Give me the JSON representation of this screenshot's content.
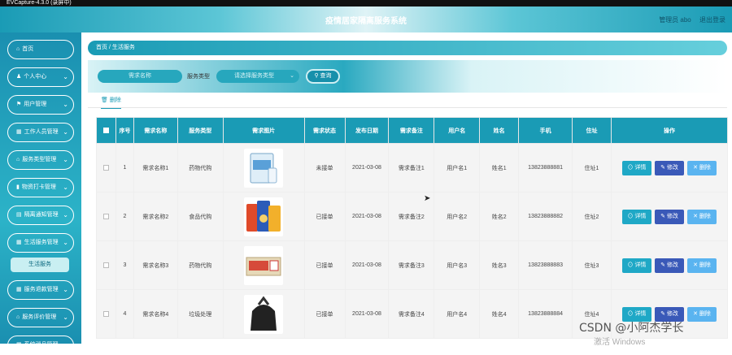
{
  "window_bar": {
    "title": "EVCapture-4.3.0 (录屏中)"
  },
  "header": {
    "title": "疫情居家隔离服务系统",
    "user_label": "管理员 abo",
    "logout_label": "退出登录"
  },
  "sidebar": {
    "items": [
      {
        "label": "首页",
        "icon": "home-icon"
      },
      {
        "label": "个人中心",
        "icon": "user-icon"
      },
      {
        "label": "用户管理",
        "icon": "flag-icon"
      },
      {
        "label": "工作人员管理",
        "icon": "grid-icon"
      },
      {
        "label": "服务类型管理",
        "icon": "home-icon"
      },
      {
        "label": "物资打卡管理",
        "icon": "chart-icon"
      },
      {
        "label": "隔离通知管理",
        "icon": "list-icon"
      },
      {
        "label": "生活服务管理",
        "icon": "grid-icon"
      },
      {
        "label": "生活服务",
        "icon": ""
      },
      {
        "label": "服务退款管理",
        "icon": "grid-icon"
      },
      {
        "label": "服务评价管理",
        "icon": "home-icon"
      },
      {
        "label": "系统消息管理",
        "icon": "grid-icon"
      }
    ]
  },
  "breadcrumb": {
    "home": "首页",
    "sep": "/",
    "current": "生活服务"
  },
  "search": {
    "name_placeholder": "需求名称",
    "type_label": "服务类型",
    "type_placeholder": "请选择服务类型",
    "search_button": "查询"
  },
  "toolbar": {
    "delete_label": "删除"
  },
  "table": {
    "headers": [
      "",
      "序号",
      "需求名称",
      "服务类型",
      "需求图片",
      "需求状态",
      "发布日期",
      "需求备注",
      "用户名",
      "姓名",
      "手机",
      "住址",
      "操作"
    ],
    "rows": [
      {
        "idx": "1",
        "name": "需求名称1",
        "type": "药物代购",
        "status": "未接单",
        "date": "2021-03-08",
        "note": "需求备注1",
        "user": "用户名1",
        "real": "姓名1",
        "phone": "13823888881",
        "addr": "住址1",
        "img": "medicine"
      },
      {
        "idx": "2",
        "name": "需求名称2",
        "type": "食品代购",
        "status": "已接单",
        "date": "2021-03-08",
        "note": "需求备注2",
        "user": "用户名2",
        "real": "姓名2",
        "phone": "13823888882",
        "addr": "住址2",
        "img": "snacks"
      },
      {
        "idx": "3",
        "name": "需求名称3",
        "type": "药物代购",
        "status": "已接单",
        "date": "2021-03-08",
        "note": "需求备注3",
        "user": "用户名3",
        "real": "姓名3",
        "phone": "13823888883",
        "addr": "住址3",
        "img": "box"
      },
      {
        "idx": "4",
        "name": "需求名称4",
        "type": "垃圾处理",
        "status": "已接单",
        "date": "2021-03-08",
        "note": "需求备注4",
        "user": "用户名4",
        "real": "姓名4",
        "phone": "13823888884",
        "addr": "住址4",
        "img": "trash"
      }
    ],
    "ops": {
      "detail": "详情",
      "edit": "修改",
      "delete": "删除"
    }
  },
  "watermark": "CSDN @小阿杰学长",
  "windows_mark": "激活 Windows",
  "colors": {
    "primary": "#1a9bb5",
    "edit": "#3a59b8",
    "delete": "#5ab4f0"
  }
}
